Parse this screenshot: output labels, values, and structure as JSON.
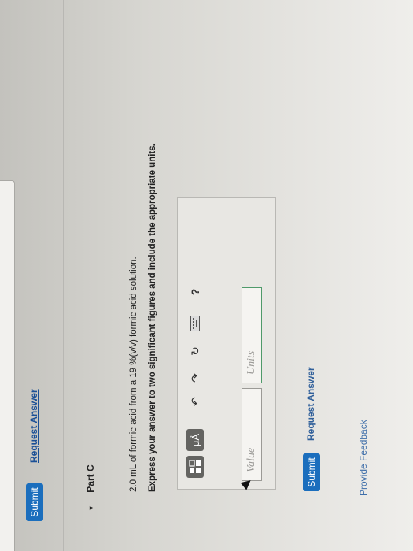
{
  "previous_part": {
    "submit_label": "Submit",
    "request_answer_label": "Request Answer"
  },
  "part_c": {
    "title": "Part C",
    "question": "2.0 mL of formic acid from a 19 %(v/v) formic acid solution.",
    "instruction": "Express your answer to two significant figures and include the appropriate units.",
    "toolbar": {
      "templates_icon": "fraction-template-icon",
      "units_label": "μÅ",
      "undo_icon": "undo-icon",
      "redo_icon": "redo-icon",
      "reset_icon": "reset-icon",
      "keyboard_icon": "keyboard-icon",
      "help_label": "?"
    },
    "value_placeholder": "Value",
    "units_placeholder": "Units",
    "submit_label": "Submit",
    "request_answer_label": "Request Answer"
  },
  "footer": {
    "provide_feedback_label": "Provide Feedback"
  },
  "colors": {
    "submit_blue": "#1b6ebd",
    "link_blue": "#1a4f96",
    "units_border_green": "#4f9a6a"
  }
}
